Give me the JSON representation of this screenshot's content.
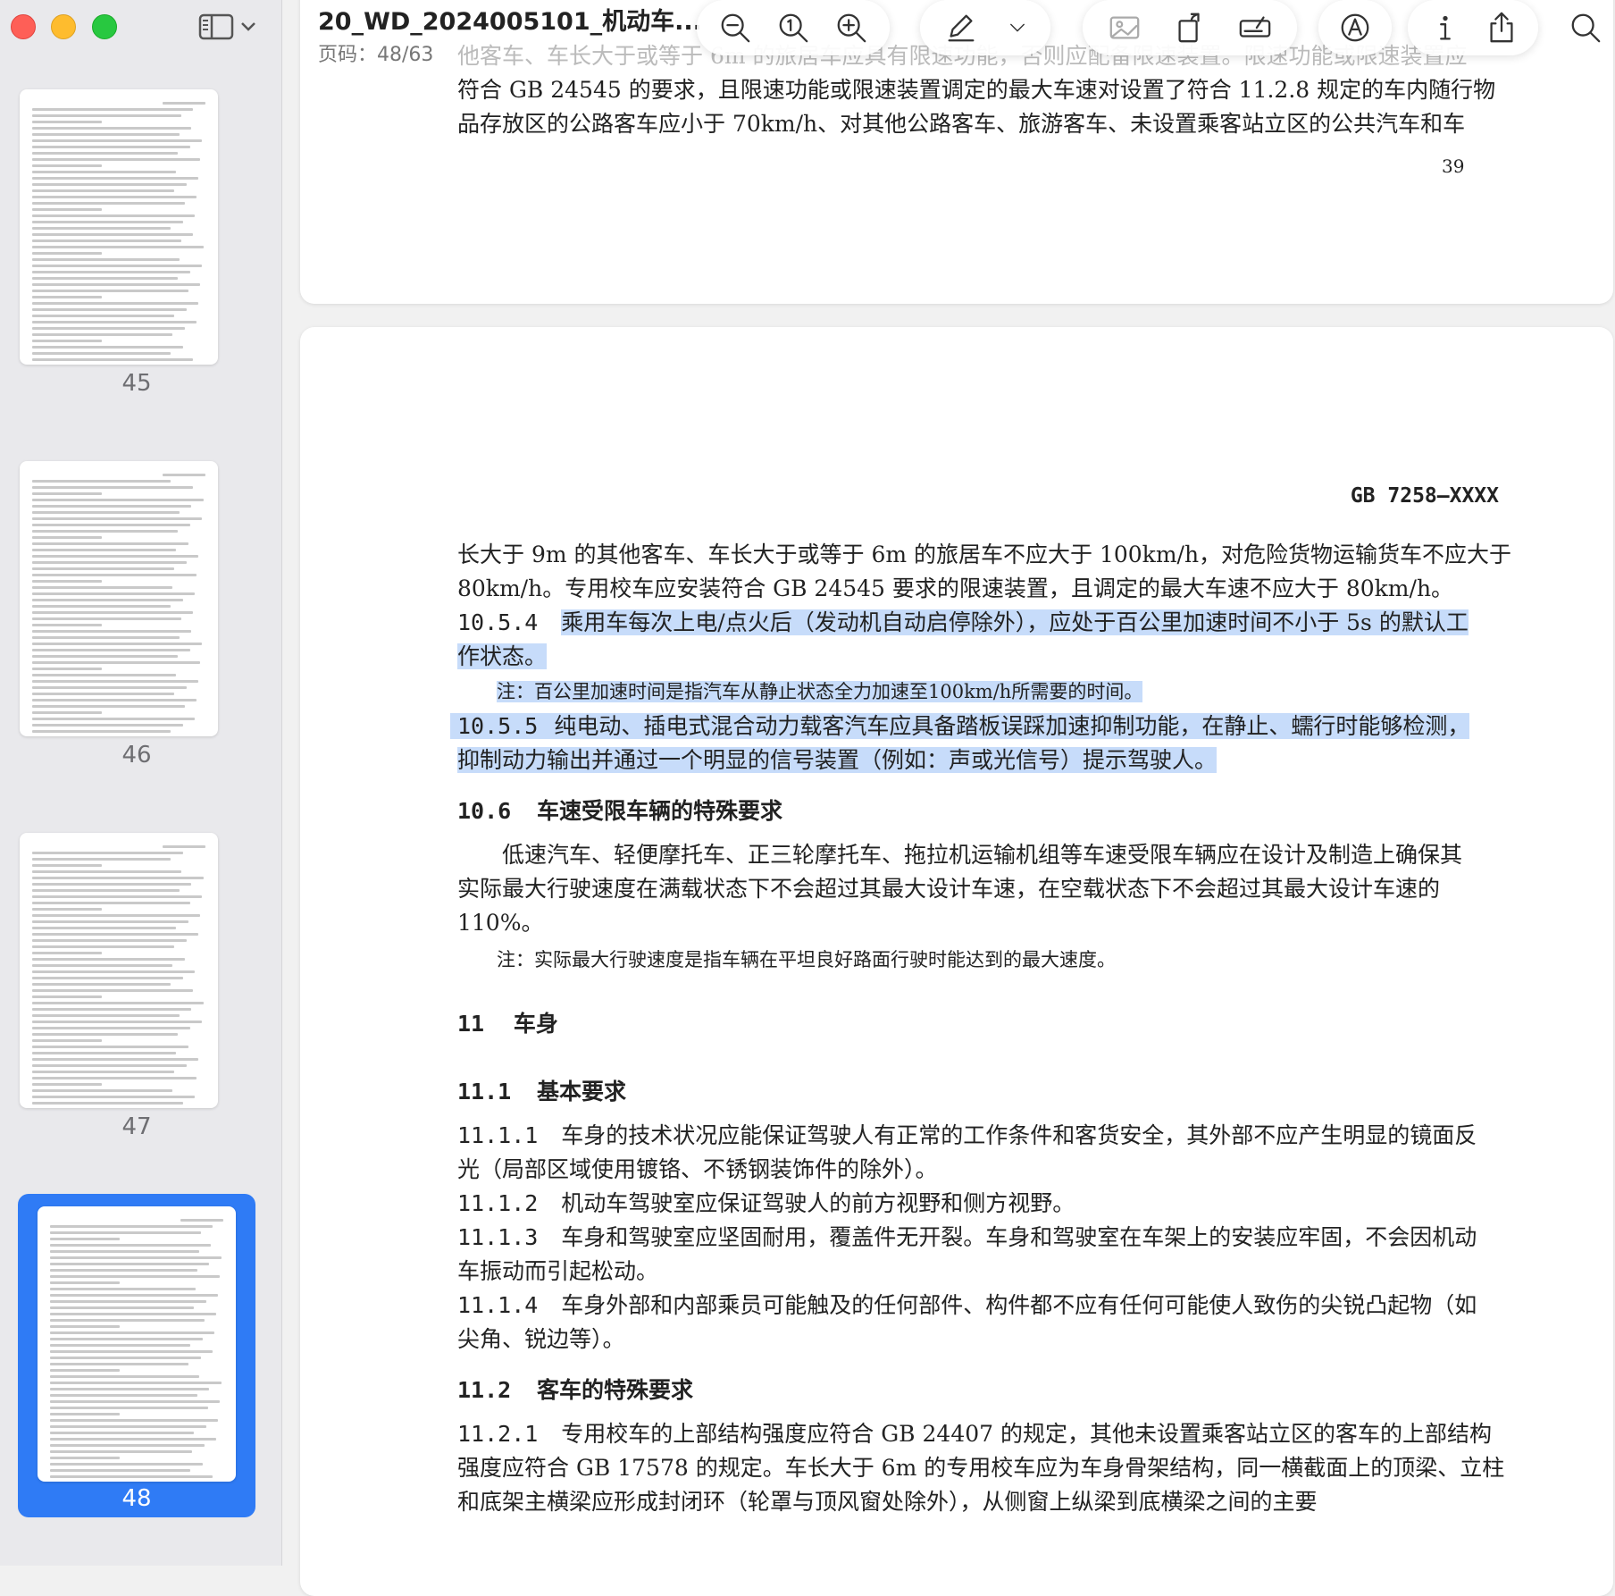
{
  "window": {
    "doc_title": "20_WD_2024005101_机动车...",
    "page_indicator": "页码：48/63"
  },
  "sidebar": {
    "thumbnails": [
      {
        "label": "45"
      },
      {
        "label": "46"
      },
      {
        "label": "47"
      },
      {
        "label": "48",
        "selected": true
      }
    ]
  },
  "toolbar": {
    "icons": [
      "zoom-out-icon",
      "actual-size-icon",
      "zoom-in-icon",
      "markup-pen-icon",
      "chevron-down-icon",
      "image-icon",
      "rotate-icon",
      "signature-icon",
      "markup-circle-icon",
      "info-icon",
      "share-icon",
      "search-icon"
    ]
  },
  "page_prev": {
    "line_top": "他客车、车长大于或等于 6m 的旅居车应具有限速功能，否则应配备限速装置。限速功能或限速装置应",
    "line1": "符合 GB 24545 的要求，且限速功能或限速装置调定的最大车速对设置了符合 11.2.8 规定的车内随行物",
    "line2": "品存放区的公路客车应小于 70km/h、对其他公路客车、旅游客车、未设置乘客站立区的公共汽车和车",
    "page_number": "39"
  },
  "page_main": {
    "header": "GB 7258—XXXX",
    "p1_line1": "长大于 9m 的其他客车、车长大于或等于 6m 的旅居车不应大于 100km/h，对危险货物运输货车不应大于",
    "p1_line2": "80km/h。专用校车应安装符合 GB 24545 要求的限速装置，且调定的最大车速不应大于 80km/h。",
    "s1054_num": "10.5.4",
    "s1054_text1": "乘用车每次上电/点火后（发动机自动启停除外），应处于百公里加速时间不小于 5s 的默认工",
    "s1054_text2": "作状态。",
    "note1": "注：百公里加速时间是指汽车从静止状态全力加速至100km/h所需要的时间。",
    "s1055_num": "10.5.5",
    "s1055_text1": "纯电动、插电式混合动力载客汽车应具备踏板误踩加速抑制功能，在静止、蠕行时能够检测，",
    "s1055_text2": "抑制动力输出并通过一个明显的信号装置（例如：声或光信号）提示驾驶人。",
    "h106_num": "10.6",
    "h106_text": "车速受限车辆的特殊要求",
    "p106_line1": "低速汽车、轻便摩托车、正三轮摩托车、拖拉机运输机组等车速受限车辆应在设计及制造上确保其",
    "p106_line2": "实际最大行驶速度在满载状态下不会超过其最大设计车速，在空载状态下不会超过其最大设计车速的",
    "p106_line3": "110%。",
    "note2": "注：实际最大行驶速度是指车辆在平坦良好路面行驶时能达到的最大速度。",
    "h11_num": "11",
    "h11_text": "车身",
    "h111_num": "11.1",
    "h111_text": "基本要求",
    "s1111_num": "11.1.1",
    "s1111_text1": "车身的技术状况应能保证驾驶人有正常的工作条件和客货安全，其外部不应产生明显的镜面反",
    "s1111_text2": "光（局部区域使用镀铬、不锈钢装饰件的除外）。",
    "s1112_num": "11.1.2",
    "s1112_text": "机动车驾驶室应保证驾驶人的前方视野和侧方视野。",
    "s1113_num": "11.1.3",
    "s1113_text1": "车身和驾驶室应坚固耐用，覆盖件无开裂。车身和驾驶室在车架上的安装应牢固，不会因机动",
    "s1113_text2": "车振动而引起松动。",
    "s1114_num": "11.1.4",
    "s1114_text1": "车身外部和内部乘员可能触及的任何部件、构件都不应有任何可能使人致伤的尖锐凸起物（如",
    "s1114_text2": "尖角、锐边等）。",
    "h112_num": "11.2",
    "h112_text": "客车的特殊要求",
    "s1121_num": "11.2.1",
    "s1121_text1": "专用校车的上部结构强度应符合 GB 24407 的规定，其他未设置乘客站立区的客车的上部结构",
    "s1121_text2": "强度应符合 GB 17578 的规定。车长大于 6m 的专用校车应为车身骨架结构，同一横截面上的顶梁、立柱",
    "s1121_text3": "和底架主横梁应形成封闭环（轮罩与顶风窗处除外），从侧窗上纵梁到底横梁之间的主要"
  }
}
